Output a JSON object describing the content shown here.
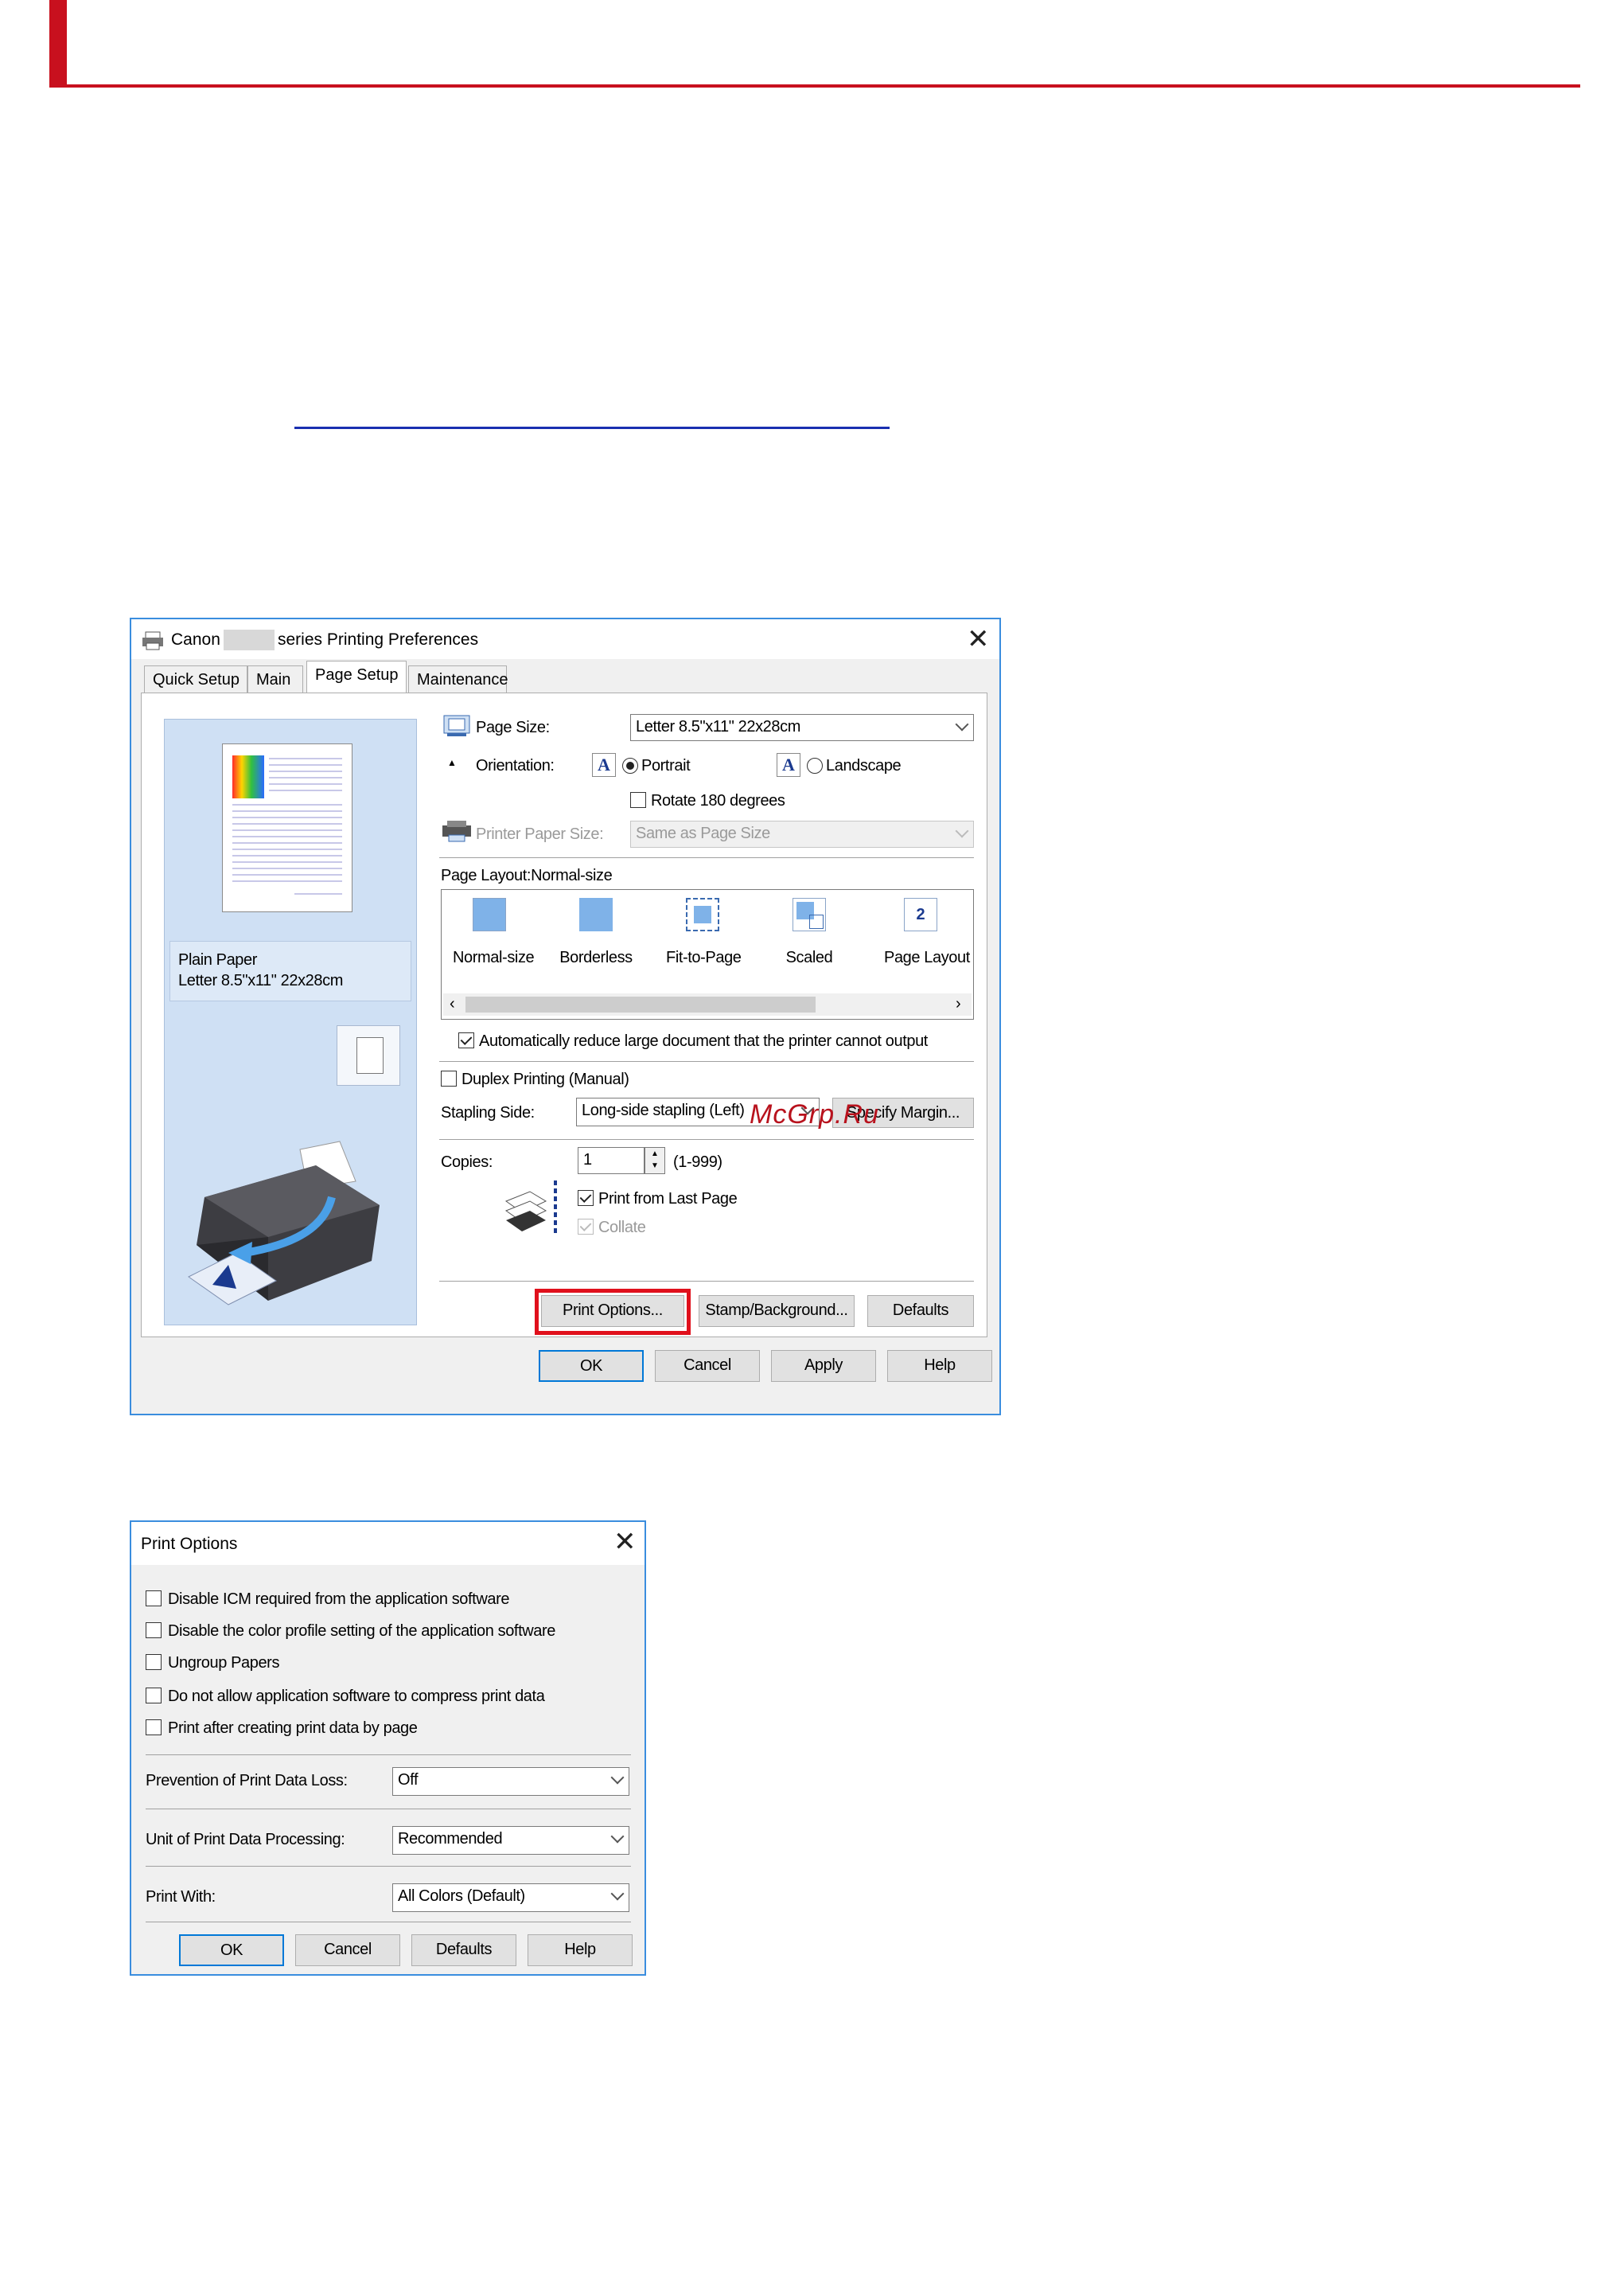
{
  "watermark": "McGrp.Ru",
  "preferences": {
    "title_prefix": "Canon",
    "title_suffix": "series Printing Preferences",
    "tabs": [
      "Quick Setup",
      "Main",
      "Page Setup",
      "Maintenance"
    ],
    "preview_text": [
      "Plain Paper",
      "Letter 8.5\"x11\" 22x28cm"
    ],
    "page_size_label": "Page Size:",
    "page_size_value": "Letter 8.5\"x11\" 22x28cm",
    "orientation_label": "Orientation:",
    "portrait": "Portrait",
    "landscape": "Landscape",
    "rotate": "Rotate 180 degrees",
    "printer_paper_label": "Printer Paper Size:",
    "printer_paper_value": "Same as Page Size",
    "page_layout_label": "Page Layout:Normal-size",
    "layouts": [
      "Normal-size",
      "Borderless",
      "Fit-to-Page",
      "Scaled",
      "Page Layout"
    ],
    "auto_reduce": "Automatically reduce large document that the printer cannot output",
    "duplex": "Duplex Printing (Manual)",
    "stapling_label": "Stapling Side:",
    "stapling_value": "Long-side stapling (Left)",
    "specify_margin": "Specify Margin...",
    "copies_label": "Copies:",
    "copies_value": "1",
    "copies_range": "(1-999)",
    "print_last_page": "Print from Last Page",
    "collate": "Collate",
    "print_options": "Print Options...",
    "stamp": "Stamp/Background...",
    "defaults": "Defaults",
    "ok": "OK",
    "cancel": "Cancel",
    "apply": "Apply",
    "help": "Help"
  },
  "options": {
    "title": "Print Options",
    "checkboxes": [
      "Disable ICM required from the application software",
      "Disable the color profile setting of the application software",
      "Ungroup Papers",
      "Do not allow application software to compress print data",
      "Print after creating print data by page"
    ],
    "prevention_label": "Prevention of Print Data Loss:",
    "prevention_value": "Off",
    "unit_label": "Unit of Print Data Processing:",
    "unit_value": "Recommended",
    "print_with_label": "Print With:",
    "print_with_value": "All Colors (Default)",
    "ok": "OK",
    "cancel": "Cancel",
    "defaults": "Defaults",
    "help": "Help"
  },
  "colors": {
    "accent_red": "#c8101e",
    "highlight": "#e0101c",
    "link": "#1a2fb0"
  }
}
